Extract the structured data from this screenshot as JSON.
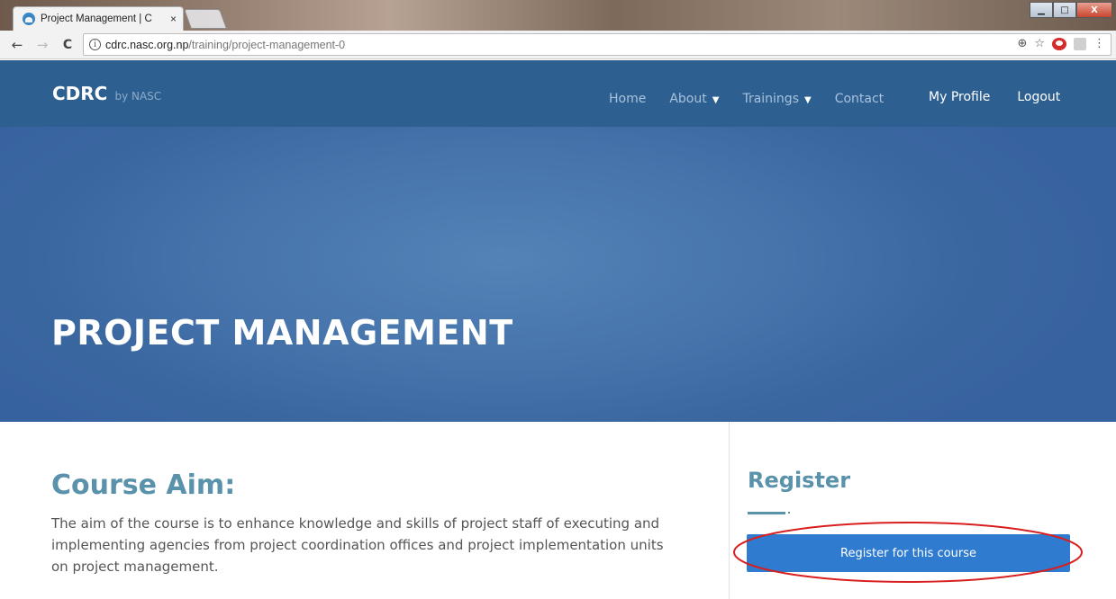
{
  "browser": {
    "tab_title": "Project Management | C",
    "tab_close": "×",
    "url_domain": "cdrc.nasc.org.np",
    "url_path": "/training/project-management-0",
    "nav_back": "←",
    "nav_forward": "→",
    "nav_reload": "C",
    "info_icon": "i",
    "window_controls": {
      "minimize": "▁",
      "maximize": "□",
      "close": "X"
    }
  },
  "site": {
    "logo_main": "CDRC",
    "logo_sub": "by NASC",
    "nav": {
      "home": "Home",
      "about": "About",
      "trainings": "Trainings",
      "contact": "Contact",
      "caret": "▼"
    },
    "user_nav": {
      "profile": "My Profile",
      "logout": "Logout"
    }
  },
  "hero": {
    "title": "PROJECT MANAGEMENT"
  },
  "course_aim": {
    "heading": "Course Aim:",
    "text": "The aim of the course is to enhance knowledge and skills of project staff of executing and implementing agencies from project coordination offices and project implementation units on project management."
  },
  "register": {
    "heading": "Register",
    "button_label": "Register for this course"
  },
  "colors": {
    "header_bg": "#2d6090",
    "hero_bg": "#4674ab",
    "accent_text": "#5a92ab",
    "button_bg": "#2f7bd0",
    "annotation": "#d81e1e"
  }
}
